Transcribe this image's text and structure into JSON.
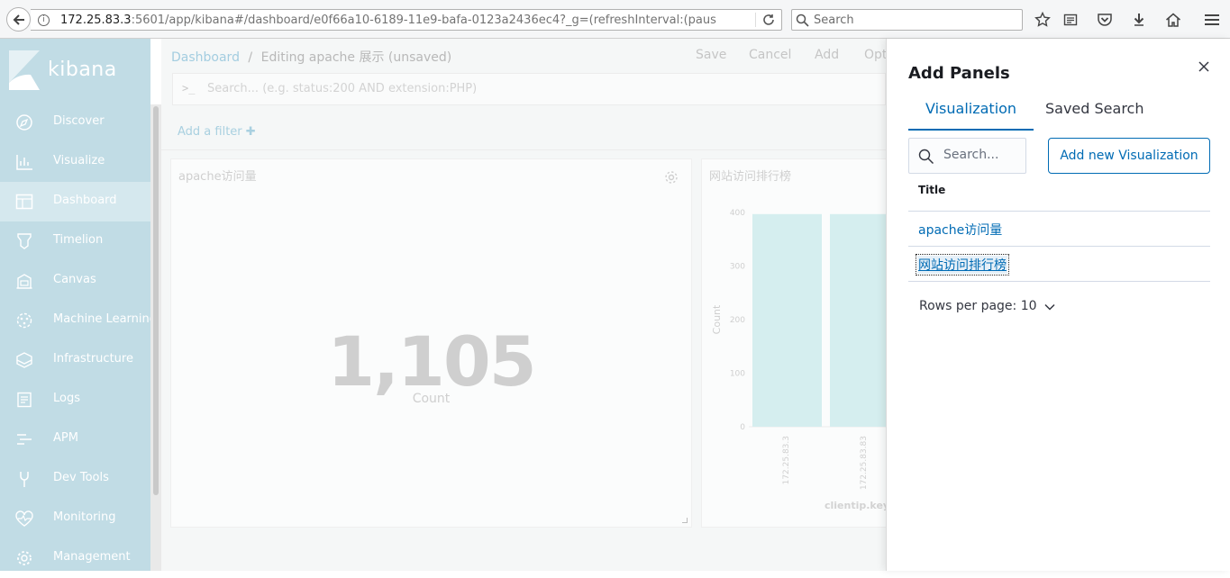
{
  "browser": {
    "url_host": "172.25.83.3",
    "url_rest": ":5601/app/kibana#/dashboard/e0f66a10-6189-11e9-bafa-0123a2436ec4?_g=(refreshInterval:(paus",
    "search_placeholder": "Search"
  },
  "sidebar": {
    "logo": "kibana",
    "items": [
      {
        "label": "Discover",
        "icon": "compass-icon"
      },
      {
        "label": "Visualize",
        "icon": "visualize-icon"
      },
      {
        "label": "Dashboard",
        "icon": "dashboard-icon",
        "active": true
      },
      {
        "label": "Timelion",
        "icon": "timelion-icon"
      },
      {
        "label": "Canvas",
        "icon": "canvas-icon"
      },
      {
        "label": "Machine Learning",
        "icon": "machine-learning-icon"
      },
      {
        "label": "Infrastructure",
        "icon": "infrastructure-icon"
      },
      {
        "label": "Logs",
        "icon": "logs-icon"
      },
      {
        "label": "APM",
        "icon": "apm-icon"
      },
      {
        "label": "Dev Tools",
        "icon": "dev-tools-icon"
      },
      {
        "label": "Monitoring",
        "icon": "monitoring-icon"
      },
      {
        "label": "Management",
        "icon": "gear-icon"
      }
    ]
  },
  "header": {
    "breadcrumb_root": "Dashboard",
    "breadcrumb_sep": "/",
    "breadcrumb_current": "Editing apache 展示 (unsaved)",
    "menu": {
      "save": "Save",
      "cancel": "Cancel",
      "add": "Add",
      "options": "Opt"
    }
  },
  "query": {
    "prompt": ">_",
    "placeholder": "Search... (e.g. status:200 AND extension:PHP)"
  },
  "filters": {
    "add_filter": "Add a filter ✚"
  },
  "panels": {
    "metric": {
      "title": "apache访问量",
      "value": "1,105",
      "label": "Count"
    },
    "chart": {
      "title": "网站访问排行榜"
    }
  },
  "chart_data": {
    "type": "bar",
    "categories": [
      "172.25.83.3",
      "172.25.83.83"
    ],
    "values": [
      397,
      397
    ],
    "ylabel": "Count",
    "xlabel": "clientip.key",
    "ylim": [
      0,
      400
    ],
    "yticks": [
      "0",
      "100",
      "200",
      "300",
      "400"
    ]
  },
  "flyout": {
    "title": "Add Panels",
    "tabs": [
      "Visualization",
      "Saved Search"
    ],
    "search_placeholder": "Search...",
    "add_button": "Add new Visualization",
    "table_header": "Title",
    "rows": [
      "apache访问量",
      "网站访问排行榜"
    ],
    "rows_per_page": "Rows per page: 10"
  },
  "colors": {
    "accent": "#006bb4",
    "sidebar": "#c1dce5",
    "bar": "#d5eeef"
  }
}
